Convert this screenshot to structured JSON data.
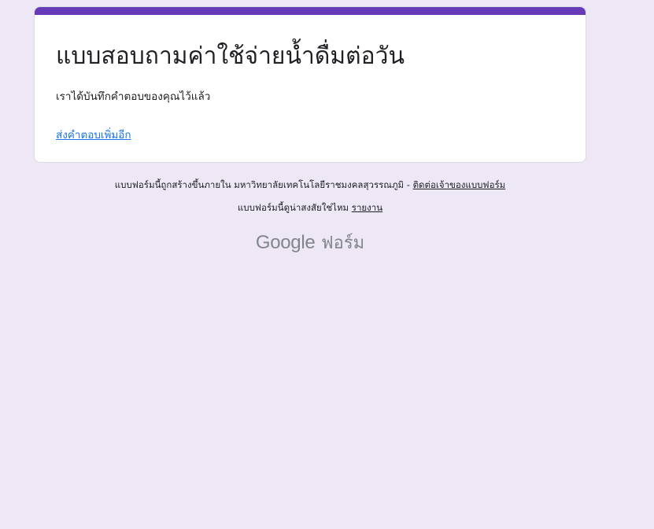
{
  "colors": {
    "background": "#ede7f6",
    "accent": "#673ab7",
    "link": "#1a73e8",
    "text": "#202124",
    "brand_gray": "#80868b"
  },
  "card": {
    "title": "แบบสอบถามค่าใช้จ่ายน้ำดื่มต่อวัน",
    "confirmation": "เราได้บันทึกคำตอบของคุณไว้แล้ว",
    "submit_another_link": "ส่งคำตอบเพิ่มอีก"
  },
  "footer": {
    "created_text": "แบบฟอร์มนี้ถูกสร้างขึ้นภายใน มหาวิทยาลัยเทคโนโลยีราชมงคลสุวรรณภูมิ - ",
    "contact_owner_link": "ติดต่อเจ้าของแบบฟอร์ม",
    "suspicious_text": "แบบฟอร์มนี้ดูน่าสงสัยใช่ไหม ",
    "report_link": "รายงาน"
  },
  "brand": {
    "google": "Google",
    "forms": "ฟอร์ม"
  }
}
